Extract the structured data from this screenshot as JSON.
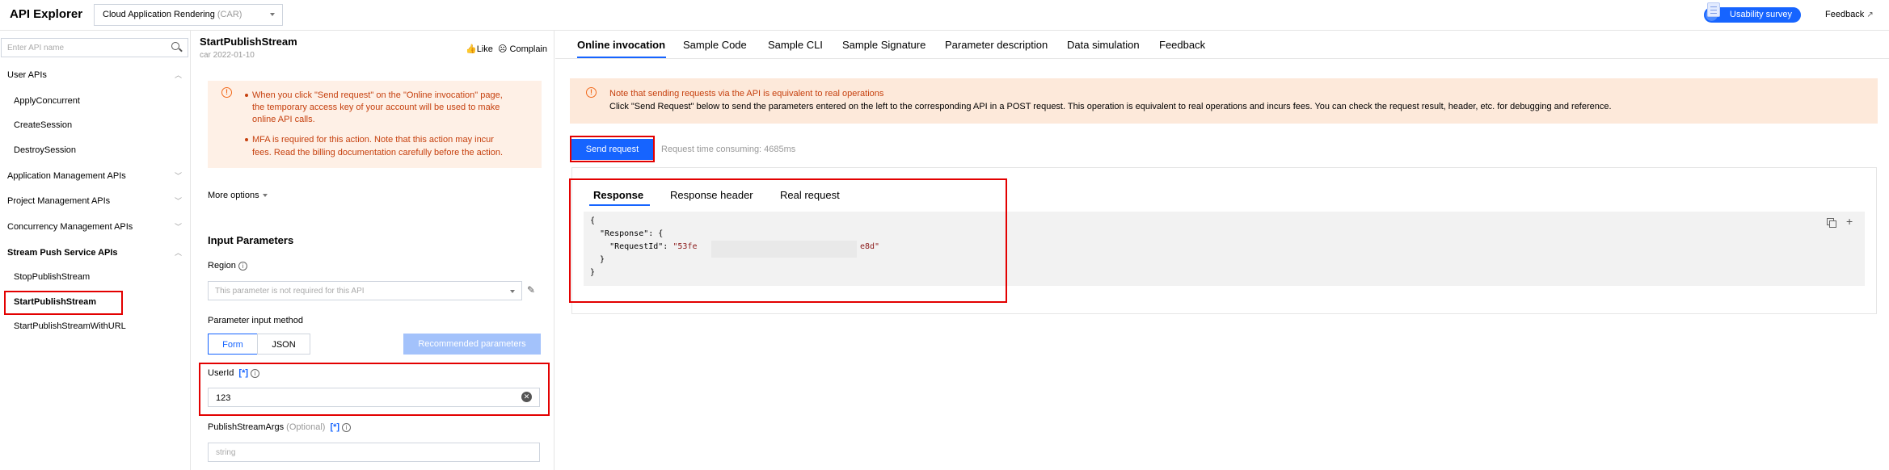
{
  "app": {
    "title": "API Explorer"
  },
  "header": {
    "product_select": {
      "label": "Cloud Application Rendering",
      "code": "(CAR)"
    },
    "survey_label": "Usability survey",
    "feedback_label": "Feedback",
    "feedback_icon": "external-link-icon"
  },
  "sidebar": {
    "search_placeholder": "Enter API name",
    "groups": [
      {
        "label": "User APIs",
        "expanded": true,
        "items": [
          "ApplyConcurrent",
          "CreateSession",
          "DestroySession"
        ]
      },
      {
        "label": "Application Management APIs",
        "expanded": false,
        "items": []
      },
      {
        "label": "Project Management APIs",
        "expanded": false,
        "items": []
      },
      {
        "label": "Concurrency Management APIs",
        "expanded": false,
        "items": []
      },
      {
        "label": "Stream Push Service APIs",
        "expanded": true,
        "items": [
          "StopPublishStream",
          "StartPublishStream",
          "StartPublishStreamWithURL"
        ]
      }
    ],
    "selected_item": "StartPublishStream"
  },
  "api_panel": {
    "api_name": "StartPublishStream",
    "version": "car 2022-01-10",
    "like_label": "Like",
    "complain_label": "Complain",
    "notices": [
      [
        "When you click \"Send request\" on the \"Online invocation\" page,",
        "the temporary access key of your account will be used to make",
        "online API calls."
      ],
      [
        "MFA is required for this action. Note that this action may incur",
        "fees. Read the billing documentation carefully before the action."
      ]
    ],
    "more_options_label": "More options",
    "input_params_title": "Input Parameters",
    "region": {
      "label": "Region",
      "placeholder": "This parameter is not required for this API"
    },
    "input_method": {
      "label": "Parameter input method",
      "form_label": "Form",
      "json_label": "JSON",
      "selected": "Form",
      "recommended_label": "Recommended parameters"
    },
    "userid": {
      "label": "UserId",
      "required_tag": "[*]",
      "value": "123"
    },
    "publish_stream_args": {
      "label": "PublishStreamArgs",
      "optional_label": "(Optional)",
      "tag": "[*]",
      "placeholder": "string"
    }
  },
  "main": {
    "tabs": [
      "Online invocation",
      "Sample Code",
      "Sample CLI",
      "Sample Signature",
      "Parameter description",
      "Data simulation",
      "Feedback"
    ],
    "active_tab": "Online invocation",
    "warning": [
      "Note that sending requests via the API is equivalent to real operations",
      "Click \"Send Request\" below to send the parameters entered on the left to the corresponding API in a POST request. This operation is equivalent to real operations and incurs fees. You can check the request result, header, etc. for debugging and reference."
    ],
    "send_label": "Send request",
    "request_time": "Request time consuming: 4685ms",
    "response_tabs": [
      "Response",
      "Response header",
      "Real request"
    ],
    "active_response_tab": "Response",
    "response_code": {
      "line1": "{",
      "line2_key": "  \"Response\": {",
      "line3_key": "    \"RequestId\": ",
      "request_id_start": "\"53fe",
      "request_id_end": "e8d\"",
      "line4": "  }",
      "line5": "}"
    }
  },
  "colors": {
    "accent": "#1664ff",
    "highlight": "#e30000",
    "warning_bg": "#fde9da",
    "warning_text": "#c6410f"
  }
}
